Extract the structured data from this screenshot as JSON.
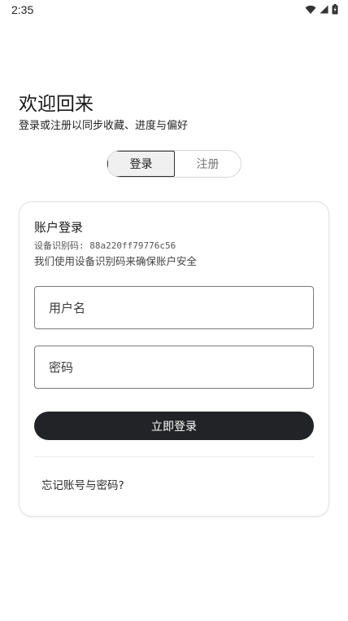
{
  "status_bar": {
    "time": "2:35",
    "icons": [
      "wifi-icon",
      "signal-icon",
      "battery-icon"
    ]
  },
  "header": {
    "title": "欢迎回来",
    "subtitle": "登录或注册以同步收藏、进度与偏好"
  },
  "tabs": [
    {
      "label": "登录",
      "active": true
    },
    {
      "label": "注册",
      "active": false
    }
  ],
  "card": {
    "title": "账户登录",
    "device_id": "设备识别码: 88a220ff79776c56",
    "device_note": "我们使用设备识别码来确保账户安全",
    "username": {
      "placeholder": "用户名",
      "value": ""
    },
    "password": {
      "placeholder": "密码",
      "value": ""
    },
    "login_button": "立即登录",
    "forgot_link": "忘记账号与密码?"
  },
  "colors": {
    "primary_button": "#222326",
    "field_border": "#7a7a7a",
    "card_border": "#e2e2e2"
  }
}
